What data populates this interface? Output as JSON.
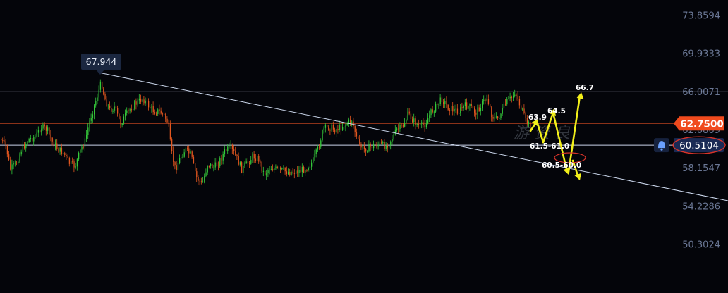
{
  "chart_data": {
    "type": "candlestick",
    "y_axis_ticks": [
      "73.8594",
      "69.9333",
      "66.0071",
      "62.0809",
      "58.1547",
      "54.2286",
      "50.3024"
    ],
    "ylim": [
      48.9,
      74.9
    ],
    "grid": false,
    "peak_callout": {
      "label": "67.944",
      "value": 67.944
    },
    "horizontal_levels": [
      {
        "name": "resistance",
        "value": 66.0,
        "color": "#c9d3ea"
      },
      {
        "name": "last-price",
        "value": 62.75,
        "color": "#b8421e"
      },
      {
        "name": "alert-line",
        "value": 60.5104,
        "color": "#c9d3ea"
      }
    ],
    "trendline": {
      "from_price": 67.944,
      "color": "#cdd9ee"
    },
    "last_price_badge": {
      "label": "62.7500",
      "color": "#f04a1d"
    },
    "alert_badge": {
      "label": "60.5104",
      "color": "#1a2a55",
      "ring": "#d8342a"
    },
    "annotations": [
      "66.7",
      "63.9",
      "64.5",
      "61.5-61.0",
      "60.5-60.0"
    ],
    "projection_color": "#f2ef1a",
    "up_color": "#35c93a",
    "down_color": "#e2561f",
    "watermark": "游 资 良"
  }
}
